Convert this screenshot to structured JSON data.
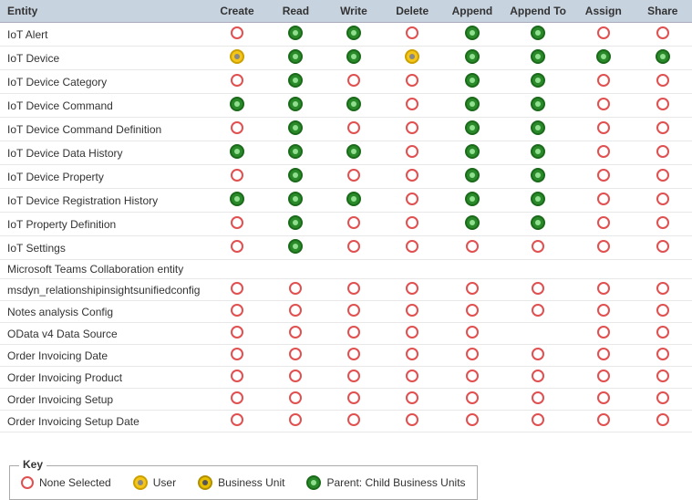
{
  "header": {
    "columns": [
      "Entity",
      "Create",
      "Read",
      "Write",
      "Delete",
      "Append",
      "Append To",
      "Assign",
      "Share"
    ]
  },
  "rows": [
    {
      "entity": "IoT Alert",
      "create": "none",
      "read": "parent",
      "write": "parent",
      "delete": "none",
      "append": "parent",
      "appendTo": "parent",
      "assign": "none",
      "share": "none"
    },
    {
      "entity": "IoT Device",
      "create": "user",
      "read": "parent",
      "write": "parent",
      "delete": "user",
      "append": "parent",
      "appendTo": "parent",
      "assign": "parent",
      "share": "parent"
    },
    {
      "entity": "IoT Device Category",
      "create": "none",
      "read": "parent",
      "write": "none",
      "delete": "none",
      "append": "parent",
      "appendTo": "parent",
      "assign": "none",
      "share": "none"
    },
    {
      "entity": "IoT Device Command",
      "create": "parent",
      "read": "parent",
      "write": "parent",
      "delete": "none",
      "append": "parent",
      "appendTo": "parent",
      "assign": "none",
      "share": "none"
    },
    {
      "entity": "IoT Device Command Definition",
      "create": "none",
      "read": "parent",
      "write": "none",
      "delete": "none",
      "append": "parent",
      "appendTo": "parent",
      "assign": "none",
      "share": "none"
    },
    {
      "entity": "IoT Device Data History",
      "create": "parent",
      "read": "parent",
      "write": "parent",
      "delete": "none",
      "append": "parent",
      "appendTo": "parent",
      "assign": "none",
      "share": "none"
    },
    {
      "entity": "IoT Device Property",
      "create": "none",
      "read": "parent",
      "write": "none",
      "delete": "none",
      "append": "parent",
      "appendTo": "parent",
      "assign": "none",
      "share": "none"
    },
    {
      "entity": "IoT Device Registration History",
      "create": "parent",
      "read": "parent",
      "write": "parent",
      "delete": "none",
      "append": "parent",
      "appendTo": "parent",
      "assign": "none",
      "share": "none"
    },
    {
      "entity": "IoT Property Definition",
      "create": "none",
      "read": "parent",
      "write": "none",
      "delete": "none",
      "append": "parent",
      "appendTo": "parent",
      "assign": "none",
      "share": "none"
    },
    {
      "entity": "IoT Settings",
      "create": "none",
      "read": "parent",
      "write": "none",
      "delete": "none",
      "append": "none",
      "appendTo": "none",
      "assign": "none",
      "share": "none"
    },
    {
      "entity": "Microsoft Teams Collaboration entity",
      "create": "",
      "read": "",
      "write": "",
      "delete": "",
      "append": "",
      "appendTo": "",
      "assign": "",
      "share": ""
    },
    {
      "entity": "msdyn_relationshipinsightsunifiedconfig",
      "create": "none",
      "read": "none",
      "write": "none",
      "delete": "none",
      "append": "none",
      "appendTo": "none",
      "assign": "none",
      "share": "none"
    },
    {
      "entity": "Notes analysis Config",
      "create": "none",
      "read": "none",
      "write": "none",
      "delete": "none",
      "append": "none",
      "appendTo": "none",
      "assign": "none",
      "share": "none"
    },
    {
      "entity": "OData v4 Data Source",
      "create": "none",
      "read": "none",
      "write": "none",
      "delete": "none",
      "append": "none",
      "appendTo": "",
      "assign": "none",
      "share": "none"
    },
    {
      "entity": "Order Invoicing Date",
      "create": "none",
      "read": "none",
      "write": "none",
      "delete": "none",
      "append": "none",
      "appendTo": "none",
      "assign": "none",
      "share": "none"
    },
    {
      "entity": "Order Invoicing Product",
      "create": "none",
      "read": "none",
      "write": "none",
      "delete": "none",
      "append": "none",
      "appendTo": "none",
      "assign": "none",
      "share": "none"
    },
    {
      "entity": "Order Invoicing Setup",
      "create": "none",
      "read": "none",
      "write": "none",
      "delete": "none",
      "append": "none",
      "appendTo": "none",
      "assign": "none",
      "share": "none"
    },
    {
      "entity": "Order Invoicing Setup Date",
      "create": "none",
      "read": "none",
      "write": "none",
      "delete": "none",
      "append": "none",
      "appendTo": "none",
      "assign": "none",
      "share": "none"
    }
  ],
  "key": {
    "title": "Key",
    "items": [
      {
        "type": "none",
        "label": "None Selected"
      },
      {
        "type": "user",
        "label": "User"
      },
      {
        "type": "business",
        "label": "Business Unit"
      },
      {
        "type": "parent",
        "label": "Parent: Child Business Units"
      }
    ]
  }
}
